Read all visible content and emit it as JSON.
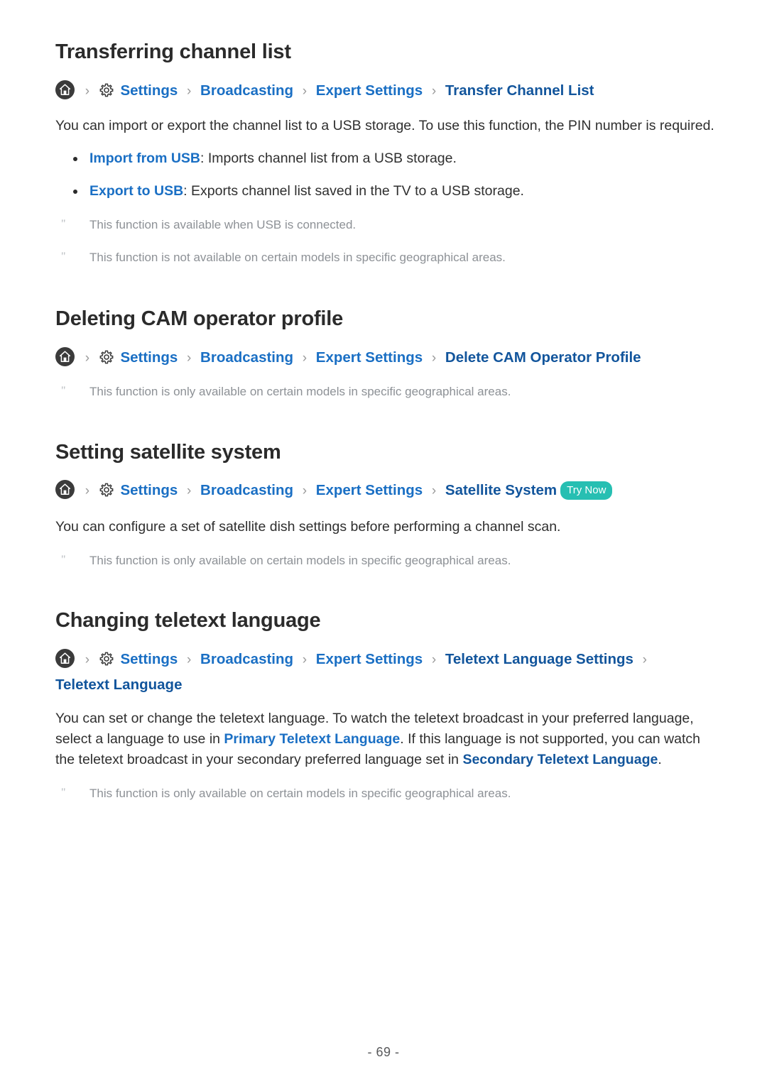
{
  "page": {
    "footer_label": "- 69 -"
  },
  "icons": {
    "home": "home-icon",
    "gear": "gear-icon",
    "separator": "›"
  },
  "colors": {
    "link_blue": "#1a6fc4",
    "link_dark_blue": "#12559c",
    "try_now_badge": "#27bfb2",
    "note_gray": "#8d9196",
    "heading": "#2b2b2b",
    "body": "#2f2f2f"
  },
  "sections": [
    {
      "title": "Transferring channel list",
      "breadcrumb": {
        "items": [
          "Settings",
          "Broadcasting",
          "Expert Settings",
          "Transfer Channel List"
        ],
        "try_now": null
      },
      "paragraphs": [
        "You can import or export the channel list to a USB storage. To use this function, the PIN number is required."
      ],
      "bullets": [
        {
          "term": "Import from USB",
          "description": ": Imports channel list from a USB storage."
        },
        {
          "term": "Export to USB",
          "description": ": Exports channel list saved in the TV to a USB storage."
        }
      ],
      "notes": [
        "This function is available when USB is connected.",
        "This function is not available on certain models in specific geographical areas."
      ]
    },
    {
      "title": "Deleting CAM operator profile",
      "breadcrumb": {
        "items": [
          "Settings",
          "Broadcasting",
          "Expert Settings",
          "Delete CAM Operator Profile"
        ],
        "try_now": null
      },
      "paragraphs": [],
      "bullets": [],
      "notes": [
        "This function is only available on certain models in specific geographical areas."
      ]
    },
    {
      "title": "Setting satellite system",
      "breadcrumb": {
        "items": [
          "Settings",
          "Broadcasting",
          "Expert Settings",
          "Satellite System"
        ],
        "try_now": "Try Now"
      },
      "paragraphs": [
        "You can configure a set of satellite dish settings before performing a channel scan."
      ],
      "bullets": [],
      "notes": [
        "This function is only available on certain models in specific geographical areas."
      ]
    },
    {
      "title": "Changing teletext language",
      "breadcrumb": {
        "items": [
          "Settings",
          "Broadcasting",
          "Expert Settings",
          "Teletext Language Settings",
          "Teletext Language"
        ],
        "try_now": null
      },
      "paragraphs": [],
      "bullets": [],
      "notes": [
        "This function is only available on certain models in specific geographical areas."
      ],
      "rich_paragraph": {
        "part1": "You can set or change the teletext language. To watch the teletext broadcast in your preferred language, select a language to use in ",
        "link1": "Primary Teletext Language",
        "part2": ". If this language is not supported, you can watch the teletext broadcast in your secondary preferred language set in ",
        "link2": "Secondary Teletext Language",
        "part3": "."
      }
    }
  ]
}
